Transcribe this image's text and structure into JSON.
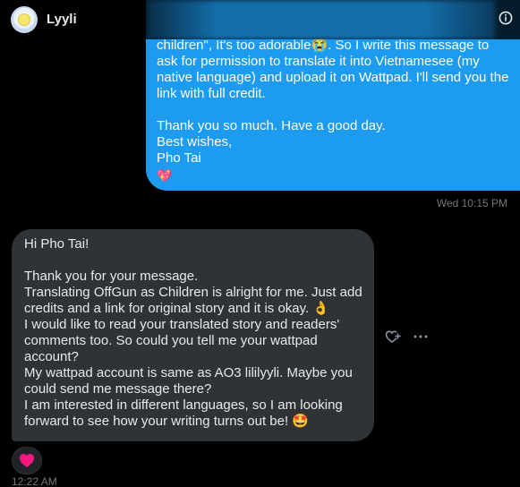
{
  "header": {
    "contact_name": "Lyyli",
    "icons": {
      "avatar": "avatar-icon",
      "info": "info-icon"
    }
  },
  "messages": {
    "outgoing": {
      "text": "children\", It's too adorable😭. So I write this message to ask for permission to translate it into Vietnamesee (my native language) and upload it on Wattpad. I'll send you the link with full credit.\n\nThank you so much. Have a good day.\nBest wishes,\nPho Tai",
      "emoji": "💖",
      "timestamp": "Wed 10:15 PM"
    },
    "incoming": {
      "text": "Hi Pho Tai!\n\nThank you for your message.\nTranslating OffGun as Children is alright for me. Just add credits and a link for original story and it is okay. 👌\nI would like to read your translated story and readers' comments too. So could you tell me your wattpad account?\nMy wattpad account is same as AO3 lililyyli. Maybe you could send me message there?\nI am interested in different languages, so I am looking forward to see how your writing turns out be! 🤩",
      "timestamp": "12:22 AM",
      "reaction": "heart-icon"
    }
  },
  "actions": {
    "react_icon": "add-reaction-icon",
    "more_icon": "more-icon"
  },
  "colors": {
    "background": "#000000",
    "outgoing_bubble": "#1d9bf0",
    "incoming_bubble": "#2f3336",
    "timestamp": "#71767b",
    "heart": "#f91880"
  }
}
